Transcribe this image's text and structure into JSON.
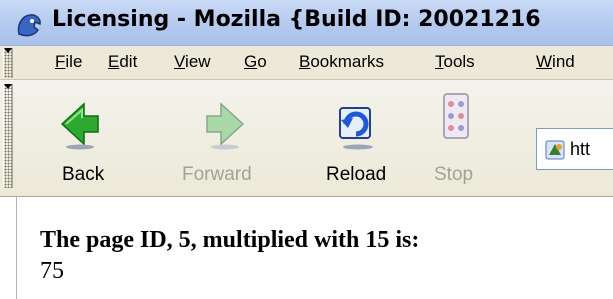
{
  "window": {
    "title": "Licensing - Mozilla {Build ID: 20021216"
  },
  "menubar": {
    "items": [
      {
        "underline": "F",
        "rest": "ile"
      },
      {
        "underline": "E",
        "rest": "dit"
      },
      {
        "underline": "V",
        "rest": "iew"
      },
      {
        "underline": "G",
        "rest": "o"
      },
      {
        "underline": "B",
        "rest": "ookmarks"
      },
      {
        "underline": "T",
        "rest": "ools"
      },
      {
        "underline": "W",
        "rest": "ind"
      }
    ]
  },
  "toolbar": {
    "back_label": "Back",
    "forward_label": "Forward",
    "reload_label": "Reload",
    "stop_label": "Stop"
  },
  "urlbar": {
    "value": "htt"
  },
  "content": {
    "heading": "The page ID, 5, multiplied with 15 is:",
    "result": "75"
  },
  "colors": {
    "titlebar": "#b3c8ee",
    "chrome": "#ece9d8",
    "disabled_text": "#a3a296"
  },
  "icons": [
    "mozilla-icon",
    "back-arrow-icon",
    "forward-arrow-icon",
    "reload-icon",
    "stop-icon",
    "site-icon"
  ]
}
